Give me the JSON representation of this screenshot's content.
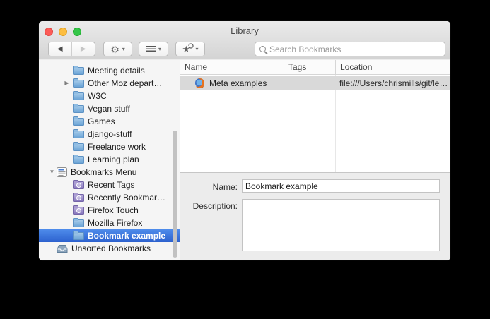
{
  "window": {
    "title": "Library"
  },
  "toolbar": {
    "back_button": "back",
    "forward_button": "forward",
    "organize_button": "organize-menu",
    "views_button": "views-menu",
    "import_backup_button": "import-and-backup-menu",
    "search_placeholder": "Search Bookmarks"
  },
  "icons": {
    "back": "◀",
    "forward": "▶",
    "caret": "▾",
    "gear": "⚙",
    "star": "★",
    "disclosure_collapsed": "▶",
    "disclosure_expanded": "▼"
  },
  "sidebar": {
    "items": [
      {
        "label": "Meeting details",
        "icon": "folder-icon",
        "depth": 2,
        "disclosure": "none",
        "selected": false
      },
      {
        "label": "Other Moz depart…",
        "icon": "folder-icon",
        "depth": 2,
        "disclosure": "collapsed",
        "selected": false
      },
      {
        "label": "W3C",
        "icon": "folder-icon",
        "depth": 2,
        "disclosure": "none",
        "selected": false
      },
      {
        "label": "Vegan stuff",
        "icon": "folder-icon",
        "depth": 2,
        "disclosure": "none",
        "selected": false
      },
      {
        "label": "Games",
        "icon": "folder-icon",
        "depth": 2,
        "disclosure": "none",
        "selected": false
      },
      {
        "label": "django-stuff",
        "icon": "folder-icon",
        "depth": 2,
        "disclosure": "none",
        "selected": false
      },
      {
        "label": "Freelance work",
        "icon": "folder-icon",
        "depth": 2,
        "disclosure": "none",
        "selected": false
      },
      {
        "label": "Learning plan",
        "icon": "folder-icon",
        "depth": 2,
        "disclosure": "none",
        "selected": false
      },
      {
        "label": "Bookmarks Menu",
        "icon": "bookmarks-menu-icon",
        "depth": 1,
        "disclosure": "expanded",
        "selected": false
      },
      {
        "label": "Recent Tags",
        "icon": "smart-folder-icon",
        "depth": 2,
        "disclosure": "none",
        "selected": false
      },
      {
        "label": "Recently Bookmar…",
        "icon": "smart-folder-icon",
        "depth": 2,
        "disclosure": "none",
        "selected": false
      },
      {
        "label": "Firefox Touch",
        "icon": "smart-folder-icon",
        "depth": 2,
        "disclosure": "none",
        "selected": false
      },
      {
        "label": "Mozilla Firefox",
        "icon": "folder-icon",
        "depth": 2,
        "disclosure": "none",
        "selected": false
      },
      {
        "label": "Bookmark example",
        "icon": "folder-icon",
        "depth": 2,
        "disclosure": "none",
        "selected": true
      },
      {
        "label": "Unsorted Bookmarks",
        "icon": "inbox-icon",
        "depth": 1,
        "disclosure": "none",
        "selected": false
      }
    ]
  },
  "list": {
    "columns": {
      "name": "Name",
      "tags": "Tags",
      "location": "Location"
    },
    "rows": [
      {
        "name": "Meta examples",
        "tags": "",
        "location": "file:///Users/chrismills/git/le…",
        "icon": "firefox-icon",
        "selected": true
      }
    ]
  },
  "details": {
    "name_label": "Name:",
    "name_value": "Bookmark example",
    "description_label": "Description:",
    "description_value": ""
  },
  "colors": {
    "selection_blue_top": "#4f8ceb",
    "selection_blue_bottom": "#2c61ce",
    "unfocused_selection_gray": "#d9d9d9",
    "window_chrome": "#e0e0e0",
    "details_bg": "#ececec"
  }
}
